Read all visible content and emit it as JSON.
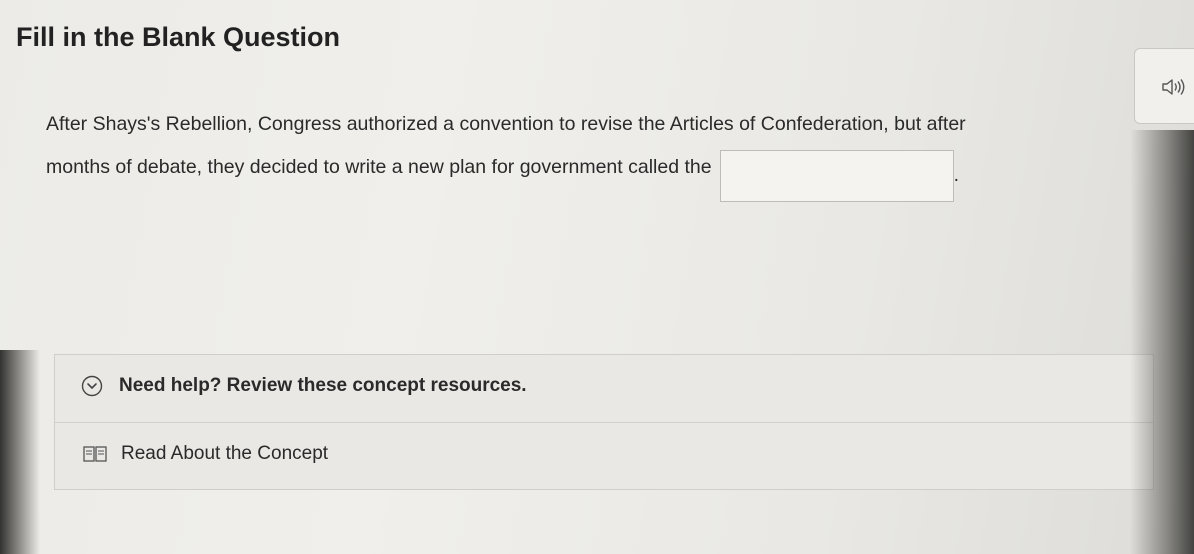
{
  "page": {
    "heading": "Fill in the Blank Question"
  },
  "audio": {
    "icon": "speaker-icon"
  },
  "question": {
    "line1": "After Shays's Rebellion, Congress authorized a convention to revise the Articles of Confederation, but after",
    "line2": "months of debate, they decided to write a new plan for government called the",
    "blank_value": "",
    "trailing": "."
  },
  "help": {
    "title": "Need help? Review these concept resources.",
    "toggle_icon": "chevron-down-circle-icon",
    "resources": [
      {
        "label": "Read About the Concept",
        "icon": "book-icon"
      }
    ]
  },
  "colors": {
    "text": "#2a2a2a",
    "background": "#ecebe7",
    "border": "#cfceca"
  }
}
